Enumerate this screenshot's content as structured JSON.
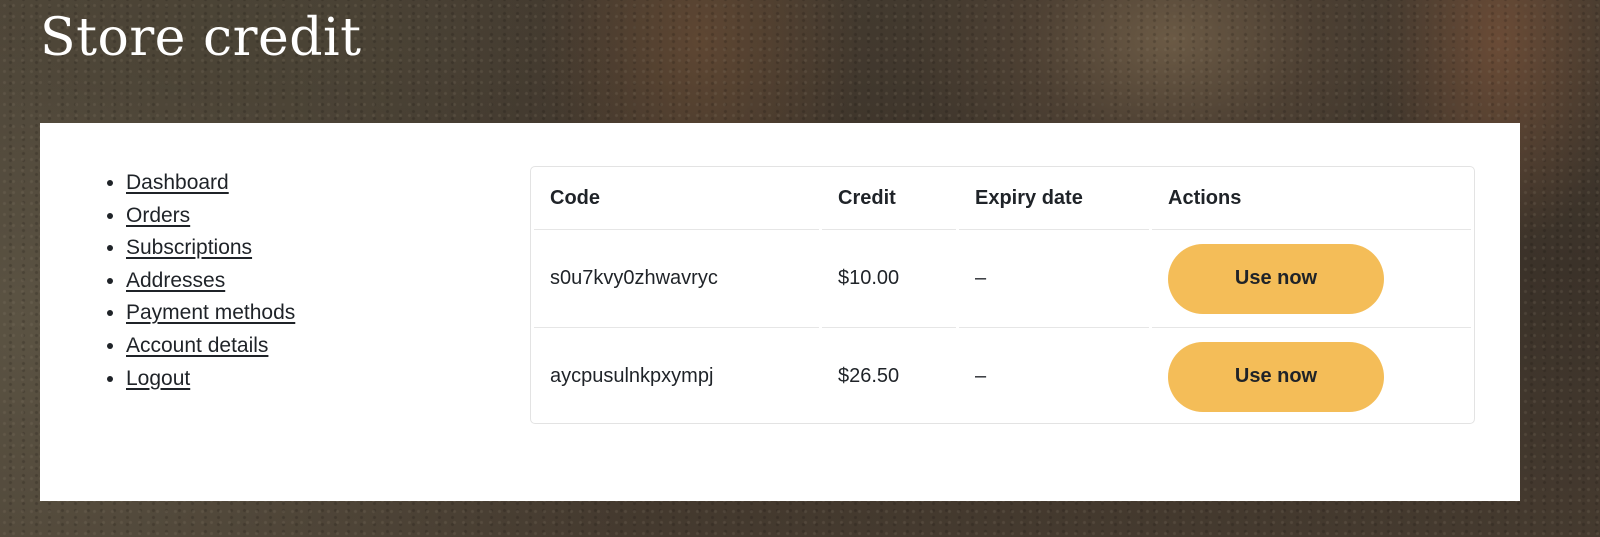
{
  "page": {
    "title": "Store credit"
  },
  "nav": {
    "items": [
      {
        "label": "Dashboard"
      },
      {
        "label": "Orders"
      },
      {
        "label": "Subscriptions"
      },
      {
        "label": "Addresses"
      },
      {
        "label": "Payment methods"
      },
      {
        "label": "Account details"
      },
      {
        "label": "Logout"
      }
    ]
  },
  "table": {
    "headers": {
      "code": "Code",
      "credit": "Credit",
      "expiry": "Expiry date",
      "actions": "Actions"
    },
    "rows": [
      {
        "code": "s0u7kvy0zhwavryc",
        "credit": "$10.00",
        "expiry": "–",
        "action": "Use now"
      },
      {
        "code": "aycpusulnkpxympj",
        "credit": "$26.50",
        "expiry": "–",
        "action": "Use now"
      }
    ]
  },
  "colors": {
    "button_accent": "#f4bd58",
    "panel_background": "#ffffff",
    "title_text": "#ffffff"
  }
}
